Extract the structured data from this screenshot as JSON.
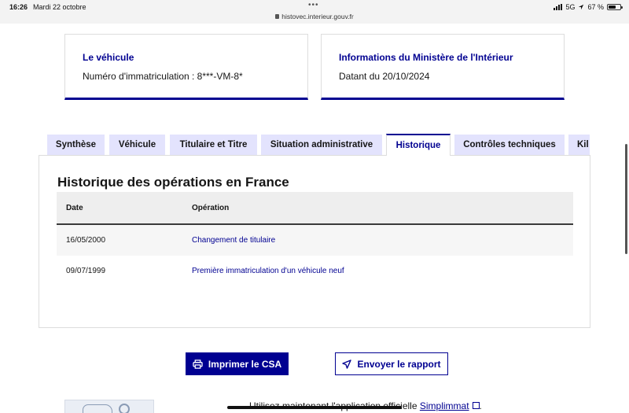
{
  "statusbar": {
    "time": "16:26",
    "date": "Mardi 22 octobre",
    "url": "histovec.interieur.gouv.fr",
    "network": "5G",
    "battery": "67 %",
    "battery_level": 0.67
  },
  "cards": {
    "vehicle": {
      "title": "Le véhicule",
      "text": "Numéro d'immatriculation : 8***-VM-8*"
    },
    "ministry": {
      "title": "Informations du Ministère de l'Intérieur",
      "text": "Datant du 20/10/2024"
    }
  },
  "tabs": [
    {
      "label": "Synthèse"
    },
    {
      "label": "Véhicule"
    },
    {
      "label": "Titulaire et Titre"
    },
    {
      "label": "Situation administrative"
    },
    {
      "label": "Historique"
    },
    {
      "label": "Contrôles techniques"
    },
    {
      "label": "Kil"
    }
  ],
  "active_tab": "Historique",
  "history": {
    "title": "Historique des opérations en France",
    "columns": [
      "Date",
      "Opération"
    ],
    "rows": [
      {
        "date": "16/05/2000",
        "operation": "Changement de titulaire"
      },
      {
        "date": "09/07/1999",
        "operation": "Première immatriculation d'un véhicule neuf"
      }
    ]
  },
  "actions": {
    "print_label": "Imprimer le CSA",
    "print_icon": "printer-icon",
    "send_label": "Envoyer le rapport",
    "send_icon": "send-icon"
  },
  "footer": {
    "text": "Utilisez maintenant l'application officielle ",
    "link": "Simplimmat",
    "suffix": "."
  },
  "colors": {
    "primary": "#000091",
    "tab_bg": "#e3e3fd",
    "row_alt": "#f6f6f6",
    "header_bg": "#eeeeee"
  }
}
